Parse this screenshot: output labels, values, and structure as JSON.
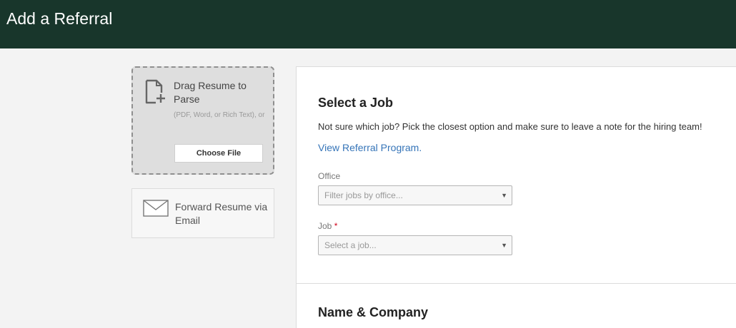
{
  "header": {
    "title": "Add a Referral"
  },
  "upload": {
    "title": "Drag Resume to Parse",
    "subtitle": "(PDF, Word, or Rich Text), or",
    "button": "Choose File",
    "icon": "document-plus-icon"
  },
  "email": {
    "title": "Forward Resume via Email",
    "icon": "envelope-icon"
  },
  "select_job": {
    "title": "Select a Job",
    "description": "Not sure which job? Pick the closest option and make sure to leave a note for the hiring team!",
    "link": "View Referral Program.",
    "office_label": "Office",
    "office_placeholder": "Filter jobs by office...",
    "job_label": "Job",
    "job_required": "*",
    "job_placeholder": "Select a job..."
  },
  "name_company": {
    "title": "Name & Company"
  },
  "colors": {
    "header": "#18362b",
    "link": "#3574b8",
    "required": "#d0021b"
  }
}
